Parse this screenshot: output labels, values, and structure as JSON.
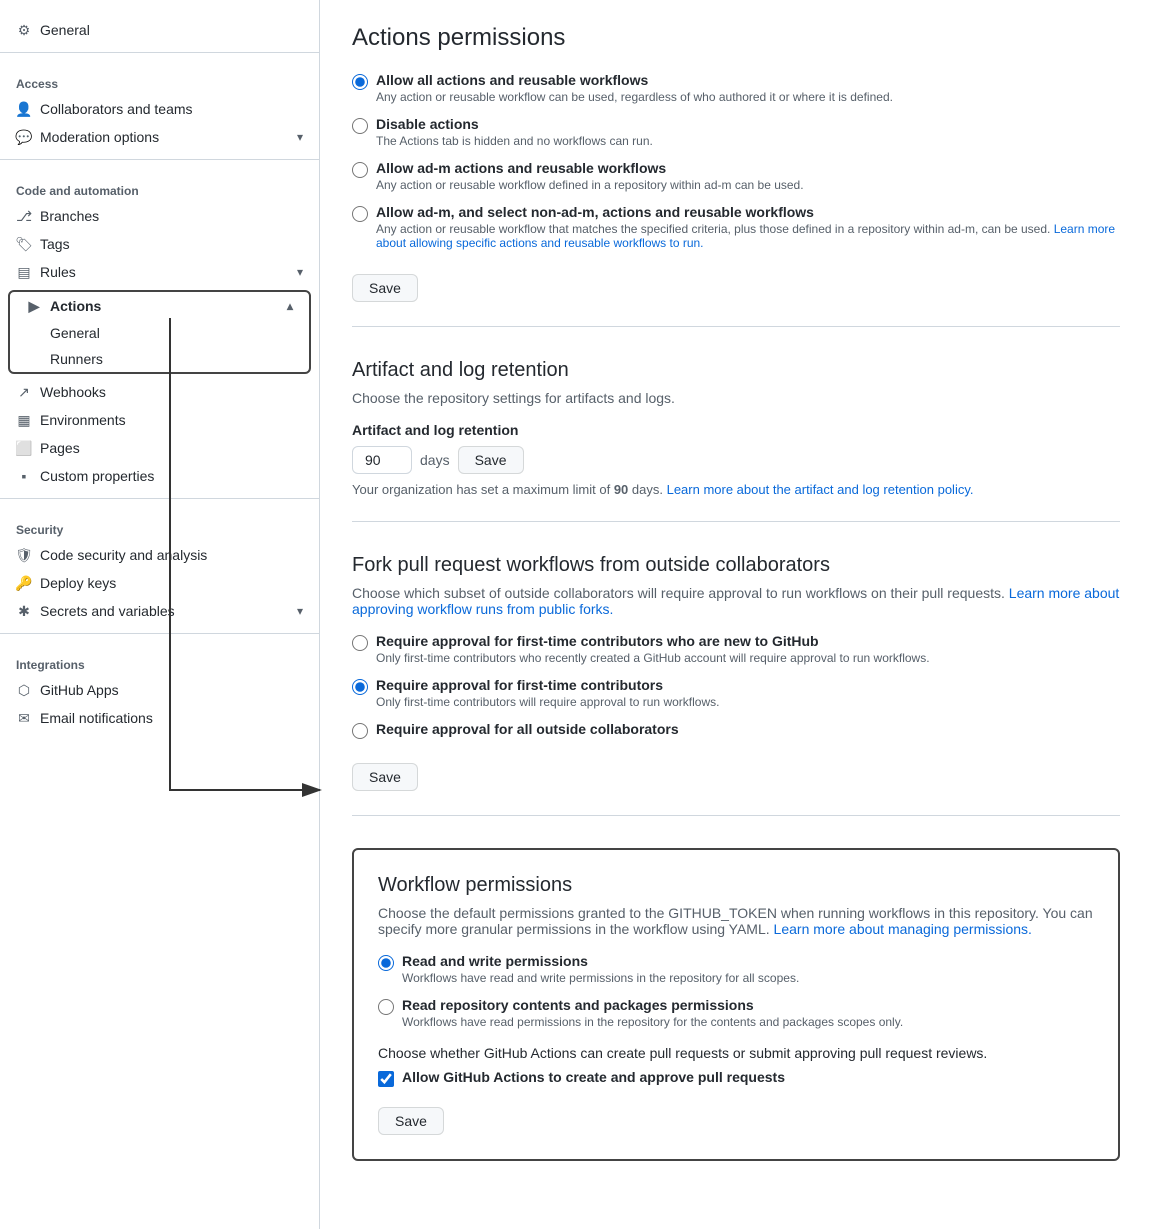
{
  "sidebar": {
    "general_label": "General",
    "access_section": "Access",
    "collaborators_label": "Collaborators and teams",
    "moderation_label": "Moderation options",
    "code_automation_section": "Code and automation",
    "branches_label": "Branches",
    "tags_label": "Tags",
    "rules_label": "Rules",
    "actions_label": "Actions",
    "general_sub_label": "General",
    "runners_label": "Runners",
    "webhooks_label": "Webhooks",
    "environments_label": "Environments",
    "pages_label": "Pages",
    "custom_properties_label": "Custom properties",
    "security_section": "Security",
    "code_security_label": "Code security and analysis",
    "deploy_keys_label": "Deploy keys",
    "secrets_label": "Secrets and variables",
    "integrations_section": "Integrations",
    "github_apps_label": "GitHub Apps",
    "email_notifications_label": "Email notifications"
  },
  "main": {
    "page_title": "Actions permissions",
    "permissions_section": {
      "radio1_label": "Allow all actions and reusable workflows",
      "radio1_desc": "Any action or reusable workflow can be used, regardless of who authored it or where it is defined.",
      "radio2_label": "Disable actions",
      "radio2_desc": "The Actions tab is hidden and no workflows can run.",
      "radio3_label": "Allow ad-m actions and reusable workflows",
      "radio3_desc": "Any action or reusable workflow defined in a repository within ad-m can be used.",
      "radio4_label": "Allow ad-m, and select non-ad-m, actions and reusable workflows",
      "radio4_desc": "Any action or reusable workflow that matches the specified criteria, plus those defined in a repository within ad-m, can be used.",
      "radio4_link": "Learn more about allowing specific actions and reusable workflows to run.",
      "save_label": "Save"
    },
    "artifact_section": {
      "title": "Artifact and log retention",
      "desc": "Choose the repository settings for artifacts and logs.",
      "sub_label": "Artifact and log retention",
      "input_value": "90",
      "days_label": "days",
      "save_label": "Save",
      "retention_note_start": "Your organization has set a maximum limit of ",
      "retention_note_bold": "90",
      "retention_note_end": " days.",
      "retention_link": "Learn more about the artifact and log retention policy."
    },
    "fork_section": {
      "title": "Fork pull request workflows from outside collaborators",
      "desc_start": "Choose which subset of outside collaborators will require approval to run workflows on their pull requests.",
      "desc_link": "Learn more about approving workflow runs from public forks.",
      "radio1_label": "Require approval for first-time contributors who are new to GitHub",
      "radio1_desc": "Only first-time contributors who recently created a GitHub account will require approval to run workflows.",
      "radio2_label": "Require approval for first-time contributors",
      "radio2_desc": "Only first-time contributors will require approval to run workflows.",
      "radio3_label": "Require approval for all outside collaborators",
      "save_label": "Save"
    },
    "workflow_section": {
      "title": "Workflow permissions",
      "desc_start": "Choose the default permissions granted to the GITHUB_TOKEN when running workflows in this repository. You can specify more granular permissions in the workflow using YAML.",
      "desc_link": "Learn more about managing permissions.",
      "radio1_label": "Read and write permissions",
      "radio1_desc": "Workflows have read and write permissions in the repository for all scopes.",
      "radio2_label": "Read repository contents and packages permissions",
      "radio2_desc": "Workflows have read permissions in the repository for the contents and packages scopes only.",
      "checkbox_desc": "Choose whether GitHub Actions can create pull requests or submit approving pull request reviews.",
      "checkbox_label": "Allow GitHub Actions to create and approve pull requests",
      "save_label": "Save"
    }
  }
}
